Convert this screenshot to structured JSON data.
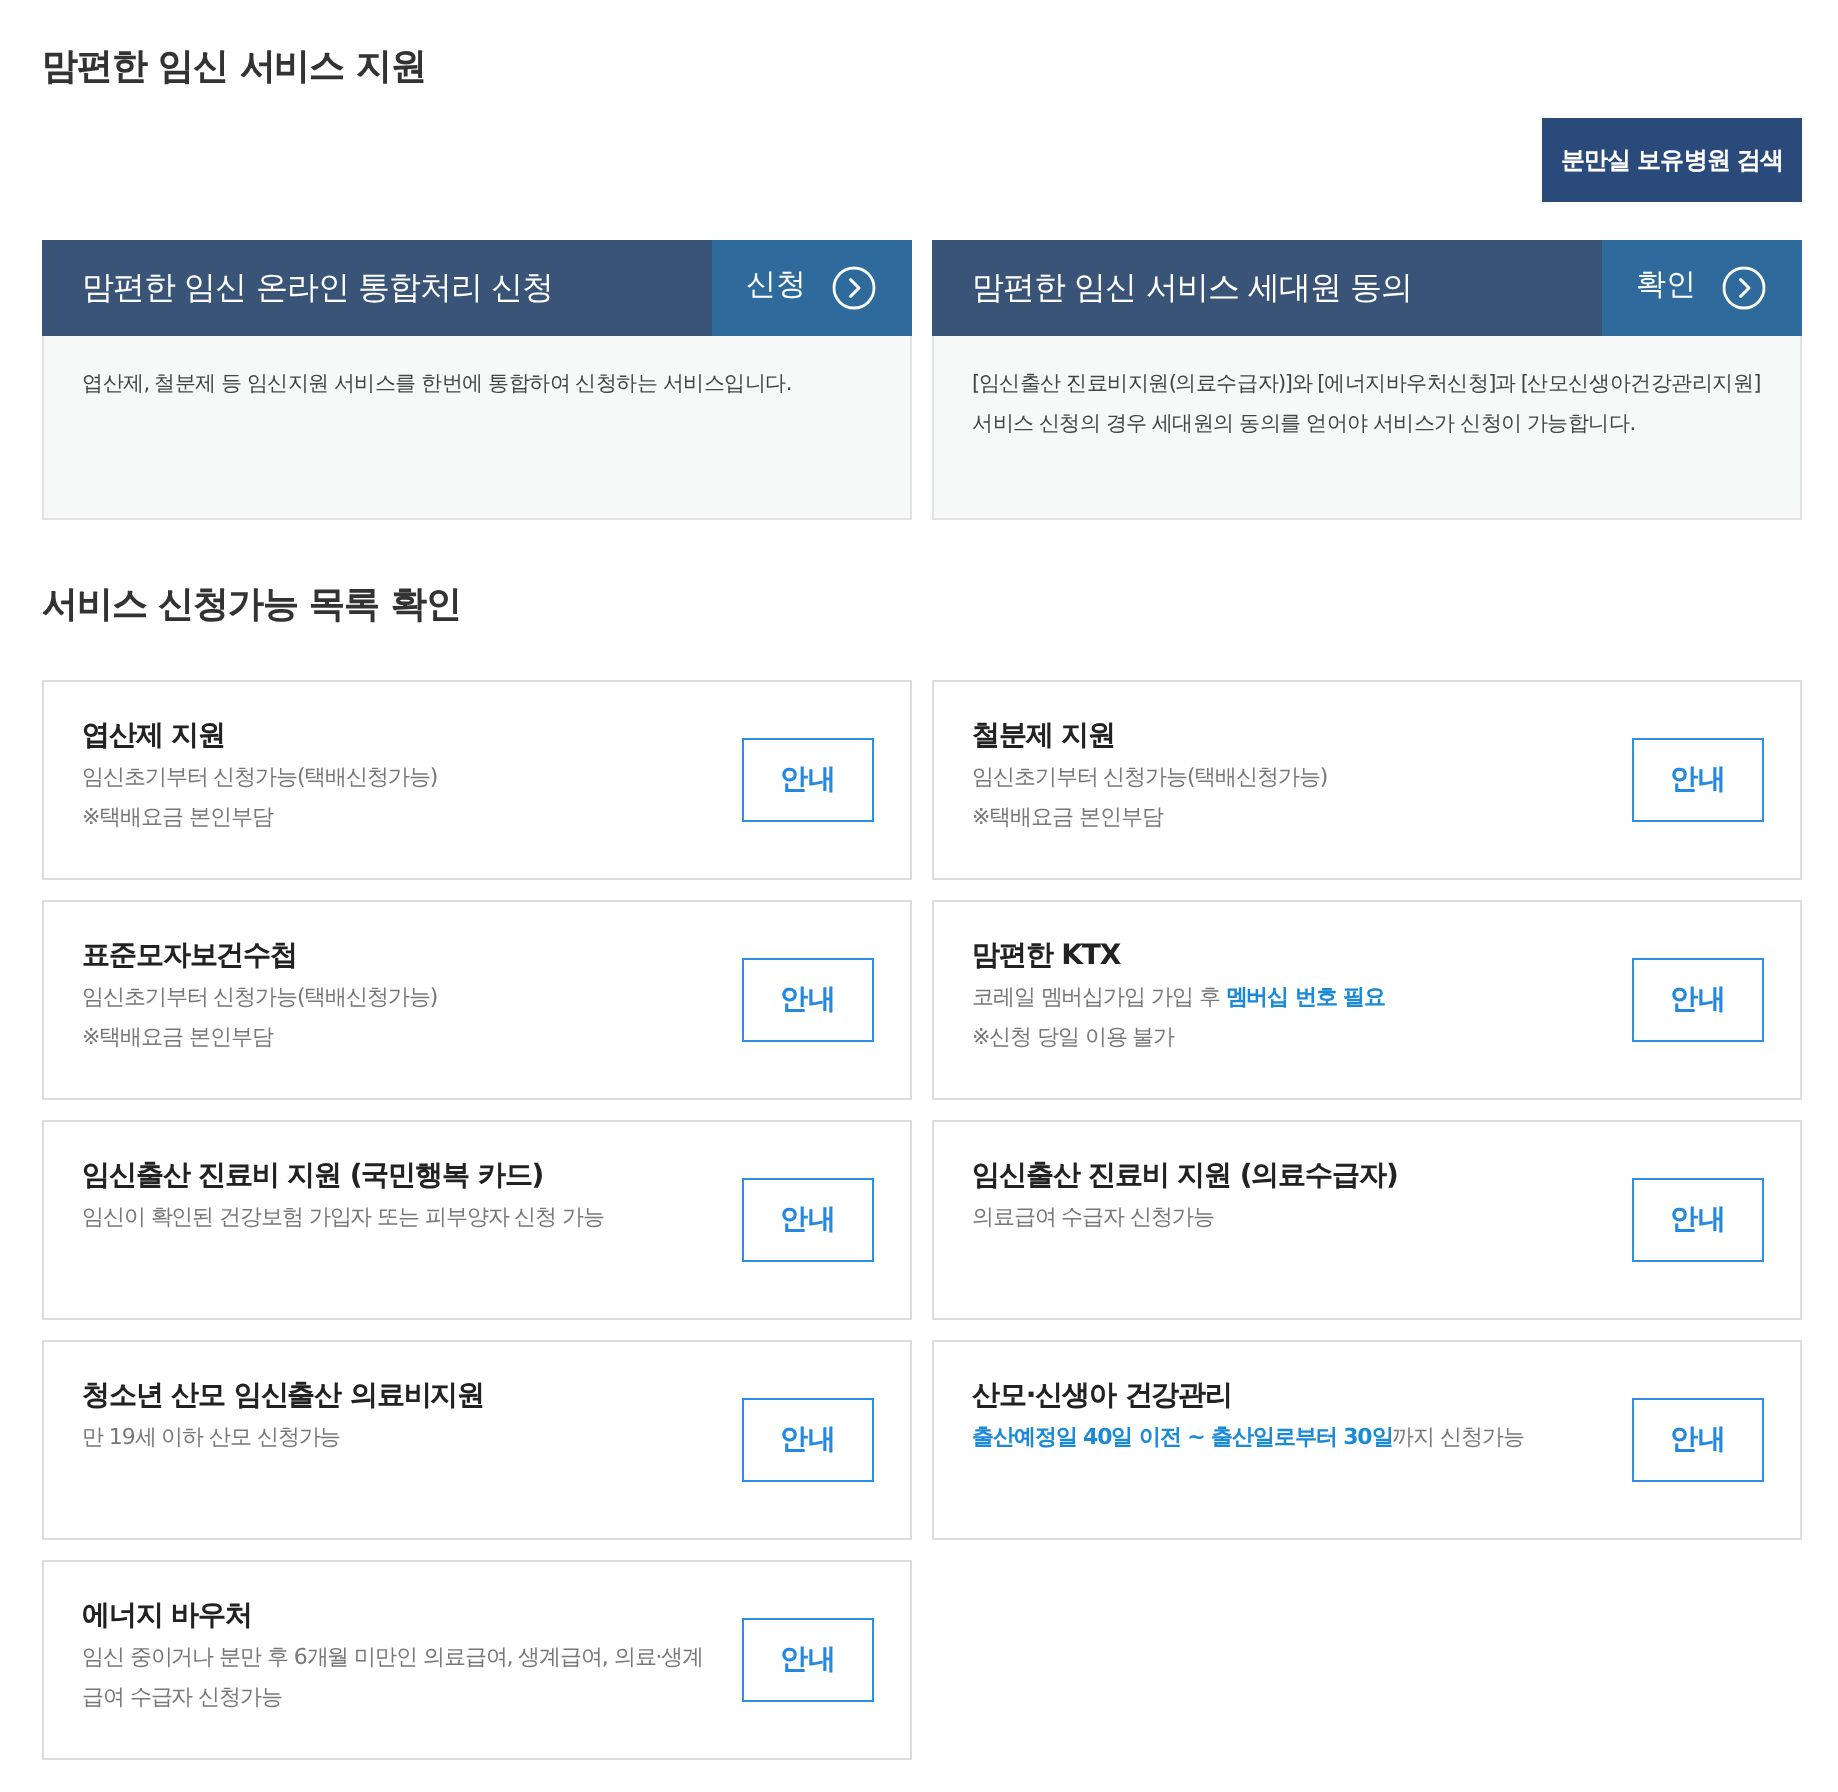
{
  "page_title": "맘편한 임신 서비스 지원",
  "hospital_search_button": "분만실 보유병원 검색",
  "feature_cards": [
    {
      "title": "맘편한 임신 온라인 통합처리 신청",
      "action": "신청",
      "description_lines": [
        "엽산제, 철분제 등 임신지원 서비스를 한번에 통합하여 신청하는 서비스입니다."
      ]
    },
    {
      "title": "맘편한 임신 서비스 세대원 동의",
      "action": "확인",
      "description_lines": [
        "[임신출산 진료비지원(의료수급자)]와 [에너지바우처신청]과 [산모신생아건강관리지원]",
        "서비스 신청의 경우 세대원의 동의를 얻어야 서비스가 신청이 가능합니다."
      ]
    }
  ],
  "section_title": "서비스 신청가능 목록 확인",
  "services": [
    {
      "title": "엽산제 지원",
      "lines": [
        "임신초기부터 신청가능(택배신청가능)",
        "※택배요금 본인부담"
      ],
      "button": "안내"
    },
    {
      "title": "철분제 지원",
      "lines": [
        "임신초기부터 신청가능(택배신청가능)",
        "※택배요금 본인부담"
      ],
      "button": "안내"
    },
    {
      "title": "표준모자보건수첩",
      "lines": [
        "임신초기부터 신청가능(택배신청가능)",
        "※택배요금 본인부담"
      ],
      "button": "안내"
    },
    {
      "title": "맘편한 KTX",
      "lines": [
        "코레일 멤버십가입 가입 후 **멤버십 번호 필요**",
        "※신청 당일 이용 불가"
      ],
      "button": "안내"
    },
    {
      "title": "임신출산 진료비 지원 (국민행복 카드)",
      "lines": [
        "임신이 확인된 건강보험 가입자 또는 피부양자 신청 가능"
      ],
      "button": "안내"
    },
    {
      "title": "임신출산 진료비 지원 (의료수급자)",
      "lines": [
        "의료급여 수급자 신청가능"
      ],
      "button": "안내"
    },
    {
      "title": "청소년 산모 임신출산 의료비지원",
      "lines": [
        "만 19세 이하 산모 신청가능"
      ],
      "button": "안내"
    },
    {
      "title": "산모·신생아 건강관리",
      "lines": [
        "**출산예정일 40일 이전 ~ 출산일로부터 30일**까지 신청가능"
      ],
      "button": "안내"
    },
    {
      "title": "에너지 바우처",
      "lines": [
        "임신 중이거나 분만 후 6개월 미만인 의료급여, 생계급여, 의료·생계급여 수급자 신청가능"
      ],
      "button": "안내"
    }
  ]
}
